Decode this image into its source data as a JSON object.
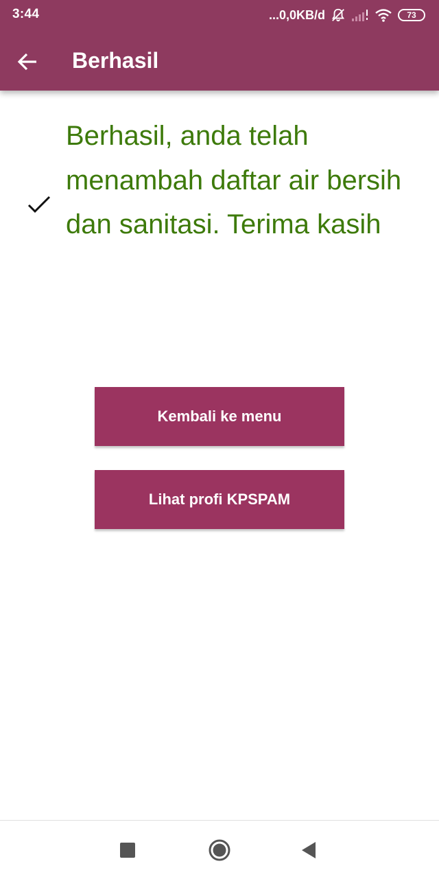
{
  "status_bar": {
    "time": "3:44",
    "network_speed": "...0,0KB/d",
    "battery_level": "73"
  },
  "app_bar": {
    "title": "Berhasil",
    "background_color": "#8e3a5f"
  },
  "content": {
    "message": "Berhasil, anda telah menambah daftar air bersih dan sanitasi. Terima kasih",
    "message_color": "#3d7a0a",
    "icon": "check-icon"
  },
  "buttons": {
    "back_to_menu": "Kembali ke menu",
    "view_profile": "Lihat profi KPSPAM",
    "button_color": "#9b3460"
  },
  "nav_bar": {
    "icons": [
      "square-recents-icon",
      "circle-home-icon",
      "triangle-back-icon"
    ]
  }
}
